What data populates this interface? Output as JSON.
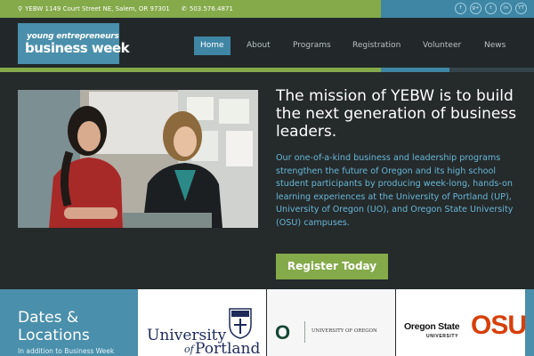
{
  "topbar": {
    "address": "YEBW 1149 Court Street NE, Salem, OR 97301",
    "phone": "503.576.4871",
    "social": [
      {
        "icon": "facebook-icon",
        "glyph": "f"
      },
      {
        "icon": "google-plus-icon",
        "glyph": "g+"
      },
      {
        "icon": "twitter-icon",
        "glyph": "t"
      },
      {
        "icon": "linkedin-icon",
        "glyph": "in"
      },
      {
        "icon": "youtube-icon",
        "glyph": "YT"
      }
    ]
  },
  "logo": {
    "line1": "young entrepreneurs",
    "line2": "business week"
  },
  "nav": {
    "items": [
      "Home",
      "About",
      "Programs",
      "Registration",
      "Volunteer",
      "News"
    ]
  },
  "hero": {
    "title": "The mission of YEBW is to build the next generation of business leaders.",
    "body": "Our one-of-a-kind business and leadership programs strengthen the future of Oregon and its high school student participants by producing week-long, hands-on learning experiences at the University of Portland (UP), University of Oregon (UO), and Oregon State University (OSU) campuses.",
    "cta": "Register Today"
  },
  "dates": {
    "title": "Dates & Locations",
    "subtitle": "In addition to Business Week"
  },
  "universities": {
    "portland": {
      "line1": "University",
      "line2": "of",
      "line3": "Portland"
    },
    "oregon": {
      "letter": "O",
      "name": "UNIVERSITY OF OREGON"
    },
    "osu": {
      "line1": "Oregon State",
      "line2": "UNIVERSITY",
      "mark": "OSU"
    }
  },
  "colors": {
    "green": "#84aa4a",
    "blue": "#3f86a5",
    "dark": "#252a2b",
    "link_blue": "#67b7d7",
    "osu_orange": "#d73f09",
    "uo_green": "#154733"
  }
}
